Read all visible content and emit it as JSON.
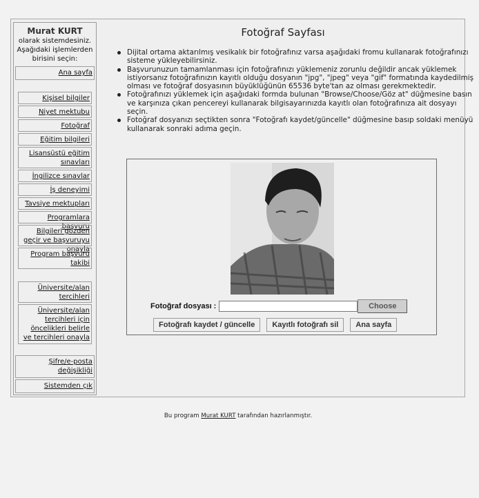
{
  "sidebar": {
    "user_name": "Murat KURT",
    "welcome_lines": [
      "olarak sistemdesiniz.",
      "Aşağıdaki işlemlerden",
      "birisini seçin:"
    ],
    "items": [
      {
        "label": "Ana sayfa"
      },
      {
        "label": "Kişisel bilgiler"
      },
      {
        "label": "Niyet mektubu"
      },
      {
        "label": "Fotoğraf"
      },
      {
        "label": "Eğitim bilgileri"
      },
      {
        "label": "Lisansüstü eğitim sınavları"
      },
      {
        "label": "İngilizce sınavlar"
      },
      {
        "label": "İş deneyimi"
      },
      {
        "label": "Tavsiye mektupları"
      },
      {
        "label": "Programlara başvuru"
      },
      {
        "label": "Bilgileri gözden geçir ve başvuruyu onayla"
      },
      {
        "label": "Program başvuru takibi"
      },
      {
        "label": "Üniversite/alan tercihleri"
      },
      {
        "label": "Üniversite/alan tercihleri için öncelikleri belirle ve tercihleri onayla"
      },
      {
        "label": "Şifre/e-posta değişikliği"
      },
      {
        "label": "Sistemden çık"
      }
    ]
  },
  "main": {
    "title": "Fotoğraf Sayfası",
    "instructions": [
      "Dijital ortama aktarılmış vesikalık bir fotoğrafınız varsa aşağıdaki fromu kullanarak fotoğrafınızı sisteme yükleyebilirsiniz.",
      "Başvurunuzun tamamlanması için fotoğrafınızı yüklemeniz zorunlu değildir ancak yüklemek istiyorsanız fotoğrafınızın kayıtlı olduğu dosyanın \"jpg\", \"jpeg\" veya \"gif\" formatında kaydedilmiş olması ve fotoğraf dosyasının büyüklüğünün 65536 byte'tan az olması gerekmektedir.",
      "Fotoğrafınızı yüklemek için aşağıdaki formda bulunan \"Browse/Choose/Göz at\" düğmesine basın ve karşınıza çıkan pencereyi kullanarak bilgisayarınızda kayıtlı olan fotoğrafınıza ait dosyayı seçin.",
      "Fotoğraf dosyanızı seçtikten sonra \"Fotoğrafı kaydet/güncelle\" düğmesine basıp soldaki menüyü kullanarak sonraki adıma geçin."
    ],
    "form": {
      "file_label": "Fotoğraf dosyası :",
      "file_value": "",
      "choose_label": "Choose",
      "save_label": "Fotoğrafı kaydet / güncelle",
      "delete_label": "Kayıtlı fotoğrafı sil",
      "home_label": "Ana sayfa"
    }
  },
  "footer": {
    "prefix": "Bu program ",
    "author": "Murat KURT",
    "suffix": " tarafından hazırlanmıştır."
  }
}
